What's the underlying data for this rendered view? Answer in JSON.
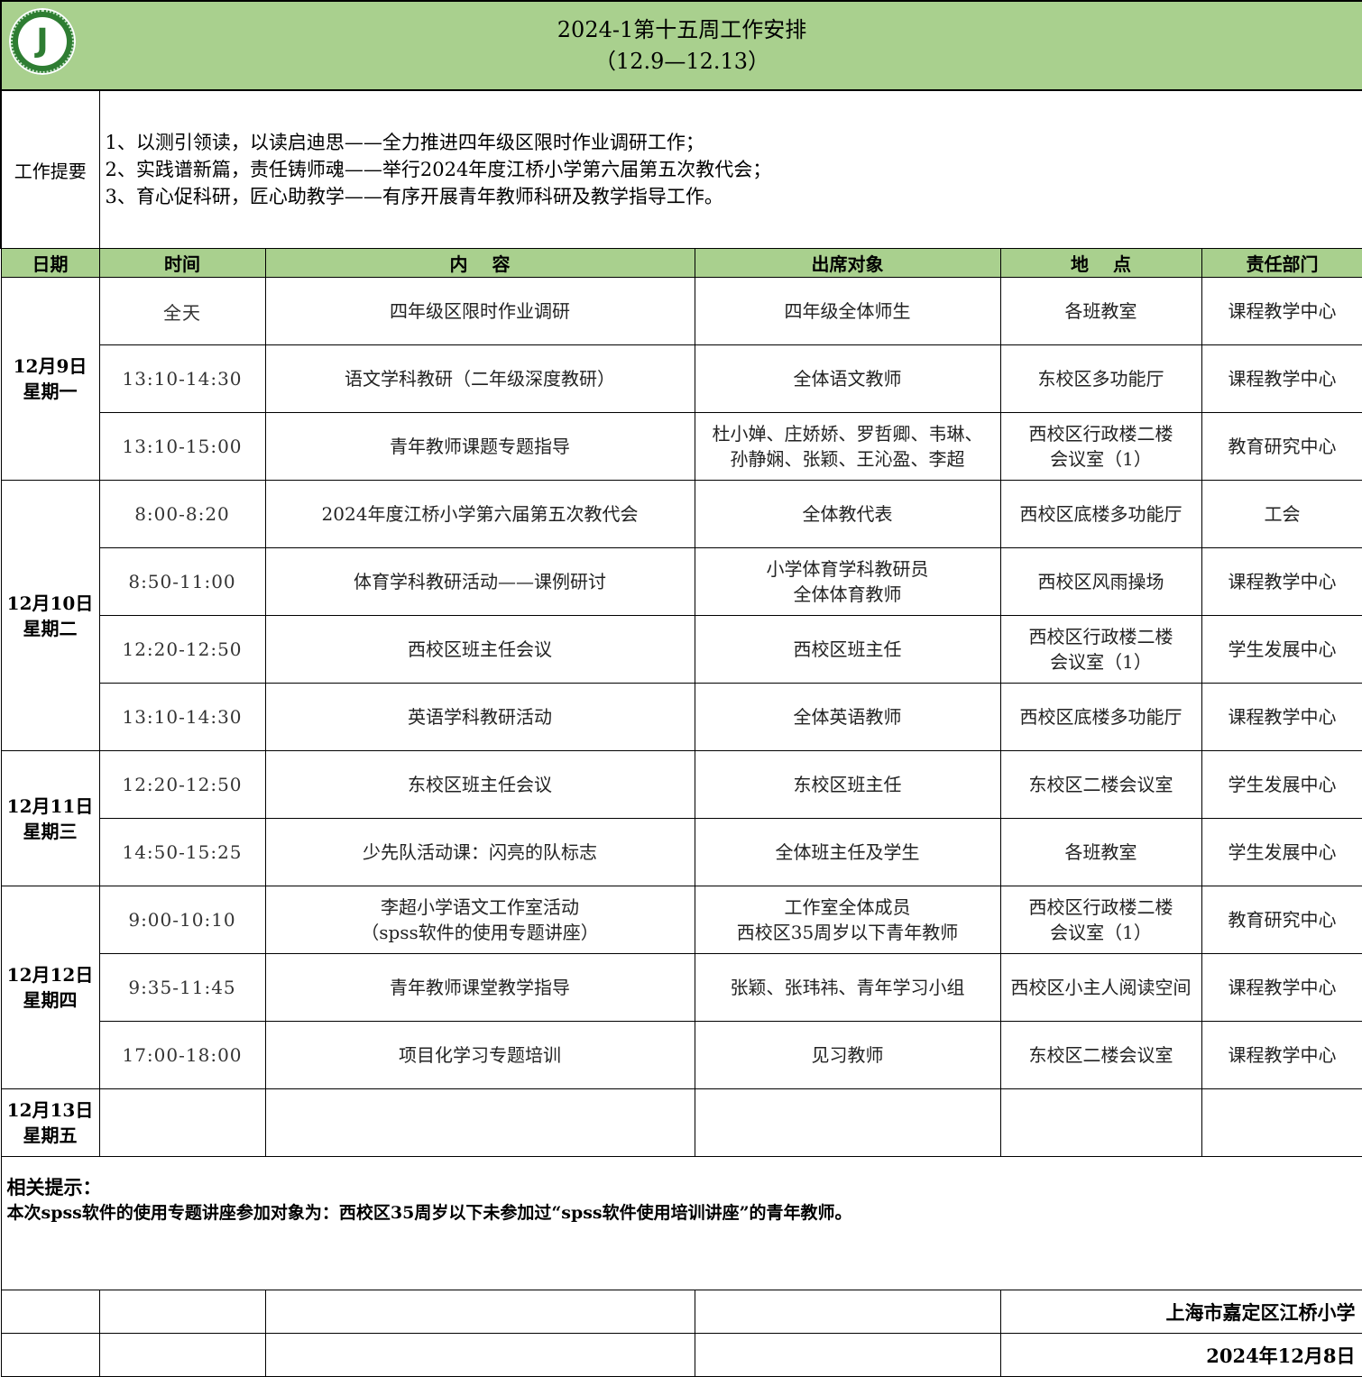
{
  "header": {
    "title_line1": "2024-1第十五周工作安排",
    "title_line2": "（12.9—12.13）",
    "logo_icon": "school-logo-icon"
  },
  "summary": {
    "label": "工作提要",
    "items": [
      "1、以测引领读，以读启迪思——全力推进四年级区限时作业调研工作；",
      "2、实践谱新篇，责任铸师魂——举行2024年度江桥小学第六届第五次教代会；",
      "3、育心促科研，匠心助教学——有序开展青年教师科研及教学指导工作。"
    ]
  },
  "columns": {
    "date": "日期",
    "time": "时间",
    "content": "内　 容",
    "attendees": "出席对象",
    "location": "地　 点",
    "department": "责任部门"
  },
  "days": [
    {
      "date": "12月9日",
      "weekday": "星期一",
      "rows": [
        {
          "time": "全天",
          "content": "四年级区限时作业调研",
          "attendees": "四年级全体师生",
          "location": "各班教室",
          "department": "课程教学中心"
        },
        {
          "time": "13:10-14:30",
          "content": "语文学科教研（二年级深度教研）",
          "attendees": "全体语文教师",
          "location": "东校区多功能厅",
          "department": "课程教学中心"
        },
        {
          "time": "13:10-15:00",
          "content": "青年教师课题专题指导",
          "attendees": "杜小婵、庄娇娇、罗哲卿、韦琳、\n孙静娴、张颖、王沁盈、李超",
          "location": "西校区行政楼二楼\n会议室（1）",
          "department": "教育研究中心"
        }
      ]
    },
    {
      "date": "12月10日",
      "weekday": "星期二",
      "rows": [
        {
          "time": "8:00-8:20",
          "content": "2024年度江桥小学第六届第五次教代会",
          "attendees": "全体教代表",
          "location": "西校区底楼多功能厅",
          "department": "工会"
        },
        {
          "time": "8:50-11:00",
          "content": "体育学科教研活动——课例研讨",
          "attendees": "小学体育学科教研员\n全体体育教师",
          "location": "西校区风雨操场",
          "department": "课程教学中心"
        },
        {
          "time": "12:20-12:50",
          "content": "西校区班主任会议",
          "attendees": "西校区班主任",
          "location": "西校区行政楼二楼\n会议室（1）",
          "department": "学生发展中心"
        },
        {
          "time": "13:10-14:30",
          "content": "英语学科教研活动",
          "attendees": "全体英语教师",
          "location": "西校区底楼多功能厅",
          "department": "课程教学中心"
        }
      ]
    },
    {
      "date": "12月11日",
      "weekday": "星期三",
      "rows": [
        {
          "time": "12:20-12:50",
          "content": "东校区班主任会议",
          "attendees": "东校区班主任",
          "location": "东校区二楼会议室",
          "department": "学生发展中心"
        },
        {
          "time": "14:50-15:25",
          "content": "少先队活动课：闪亮的队标志",
          "attendees": "全体班主任及学生",
          "location": "各班教室",
          "department": "学生发展中心"
        }
      ]
    },
    {
      "date": "12月12日",
      "weekday": "星期四",
      "rows": [
        {
          "time": "9:00-10:10",
          "content": "李超小学语文工作室活动\n（spss软件的使用专题讲座）",
          "attendees": "工作室全体成员\n西校区35周岁以下青年教师",
          "location": "西校区行政楼二楼\n会议室（1）",
          "department": "教育研究中心"
        },
        {
          "time": "9:35-11:45",
          "content": "青年教师课堂教学指导",
          "attendees": "张颖、张玮祎、青年学习小组",
          "location": "西校区小主人阅读空间",
          "department": "课程教学中心"
        },
        {
          "time": "17:00-18:00",
          "content": "项目化学习专题培训",
          "attendees": "见习教师",
          "location": "东校区二楼会议室",
          "department": "课程教学中心"
        }
      ]
    },
    {
      "date": "12月13日",
      "weekday": "星期五",
      "rows": [
        {
          "time": "",
          "content": "",
          "attendees": "",
          "location": "",
          "department": ""
        }
      ]
    }
  ],
  "tips": {
    "title": "相关提示：",
    "body": "本次spss软件的使用专题讲座参加对象为：西校区35周岁以下未参加过“spss软件使用培训讲座”的青年教师。"
  },
  "footer": {
    "school": "上海市嘉定区江桥小学",
    "date": "2024年12月8日"
  }
}
